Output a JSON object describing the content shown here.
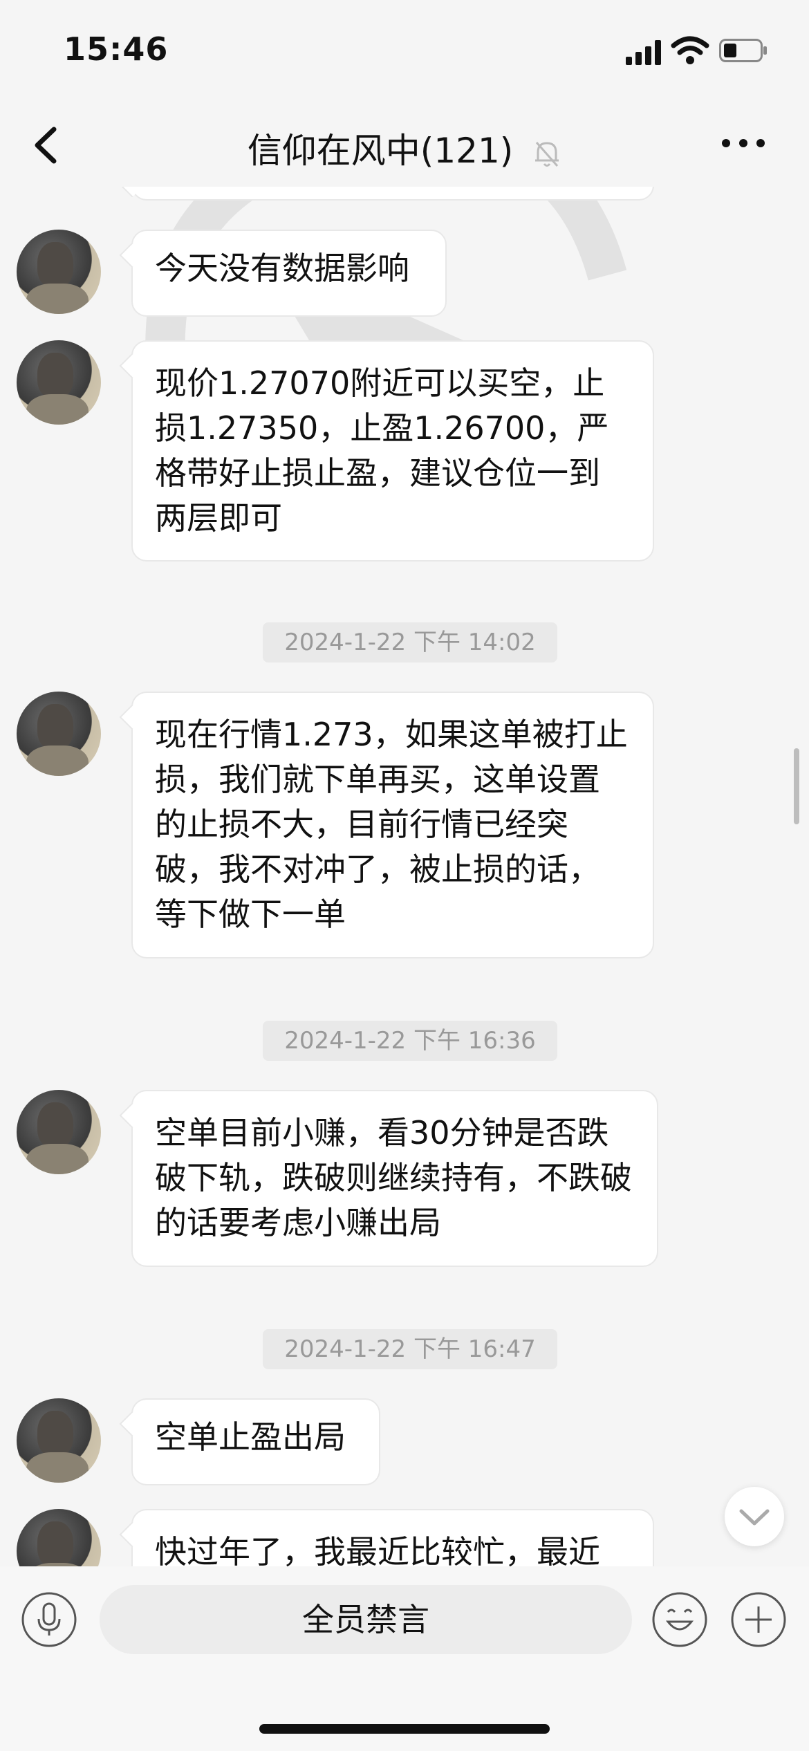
{
  "status_bar": {
    "time": "15:46"
  },
  "header": {
    "title": "信仰在风中(121)"
  },
  "messages": [
    {
      "type": "text",
      "text": "今天没有数据影响"
    },
    {
      "type": "text",
      "text": "现价1.27070附近可以买空，止损1.27350，止盈1.26700，严格带好止损止盈，建议仓位一到两层即可"
    },
    {
      "type": "timestamp",
      "text": "2024-1-22 下午 14:02"
    },
    {
      "type": "text",
      "text": "现在行情1.273，如果这单被打止损，我们就下单再买，这单设置的止损不大，目前行情已经突破，我不对冲了，被止损的话，等下做下一单"
    },
    {
      "type": "timestamp",
      "text": "2024-1-22 下午 16:36"
    },
    {
      "type": "text",
      "text": "空单目前小赚，看30分钟是否跌破下轨，跌破则继续持有，不跌破的话要考虑小赚出局"
    },
    {
      "type": "timestamp",
      "text": "2024-1-22 下午 16:47"
    },
    {
      "type": "text",
      "text": "空单止盈出局"
    },
    {
      "type": "text",
      "text": "快过年了，我最近比较忙，最近"
    }
  ],
  "input_bar": {
    "muted_text": "全员禁言"
  },
  "icons": {
    "back": "chevron-left-icon",
    "bell": "bell-muted-icon",
    "more": "more-dots-icon",
    "mic": "microphone-icon",
    "emoji": "emoji-icon",
    "plus": "plus-icon",
    "jump": "chevron-down-icon"
  }
}
